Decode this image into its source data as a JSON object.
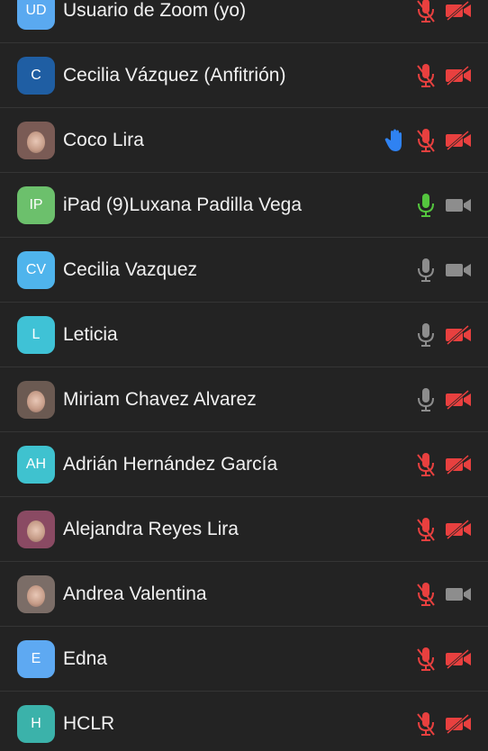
{
  "colors": {
    "background": "#232323",
    "divider": "#353535",
    "muted_red": "#e8403f",
    "active_green": "#54c53e",
    "idle_gray": "#8d8d8d",
    "hand_blue": "#2f82f2"
  },
  "participants": [
    {
      "initials": "UD",
      "name": "Usuario de Zoom (yo)",
      "avatar_color": "#5aa9f0",
      "avatar_type": "initials",
      "hand_raised": false,
      "mic": "muted",
      "camera": "off"
    },
    {
      "initials": "C",
      "name": "Cecilia Vázquez (Anfitrión)",
      "avatar_color": "#1f5ea3",
      "avatar_type": "initials",
      "hand_raised": false,
      "mic": "muted",
      "camera": "off"
    },
    {
      "initials": "",
      "name": "Coco Lira",
      "avatar_color": "#7a5b55",
      "avatar_type": "photo",
      "hand_raised": true,
      "mic": "muted",
      "camera": "off"
    },
    {
      "initials": "IP",
      "name": "iPad (9)Luxana Padilla Vega",
      "avatar_color": "#6cc06c",
      "avatar_type": "initials",
      "hand_raised": false,
      "mic": "active",
      "camera": "on"
    },
    {
      "initials": "CV",
      "name": "Cecilia Vazquez",
      "avatar_color": "#4fb4ec",
      "avatar_type": "initials",
      "hand_raised": false,
      "mic": "on",
      "camera": "on"
    },
    {
      "initials": "L",
      "name": "Leticia",
      "avatar_color": "#3fc2d6",
      "avatar_type": "initials",
      "hand_raised": false,
      "mic": "on",
      "camera": "off"
    },
    {
      "initials": "",
      "name": "Miriam Chavez Alvarez",
      "avatar_color": "#6b5a52",
      "avatar_type": "photo",
      "hand_raised": false,
      "mic": "on",
      "camera": "off"
    },
    {
      "initials": "AH",
      "name": "Adrián Hernández García",
      "avatar_color": "#3fc2cf",
      "avatar_type": "initials",
      "hand_raised": false,
      "mic": "muted",
      "camera": "off"
    },
    {
      "initials": "",
      "name": "Alejandra Reyes Lira",
      "avatar_color": "#8a4a63",
      "avatar_type": "photo",
      "hand_raised": false,
      "mic": "muted",
      "camera": "off"
    },
    {
      "initials": "",
      "name": "Andrea Valentina",
      "avatar_color": "#7b6d67",
      "avatar_type": "photo",
      "hand_raised": false,
      "mic": "muted",
      "camera": "on"
    },
    {
      "initials": "E",
      "name": "Edna",
      "avatar_color": "#5ea9f2",
      "avatar_type": "initials",
      "hand_raised": false,
      "mic": "muted",
      "camera": "off"
    },
    {
      "initials": "H",
      "name": "HCLR",
      "avatar_color": "#3bb2aa",
      "avatar_type": "initials",
      "hand_raised": false,
      "mic": "muted",
      "camera": "off"
    }
  ]
}
